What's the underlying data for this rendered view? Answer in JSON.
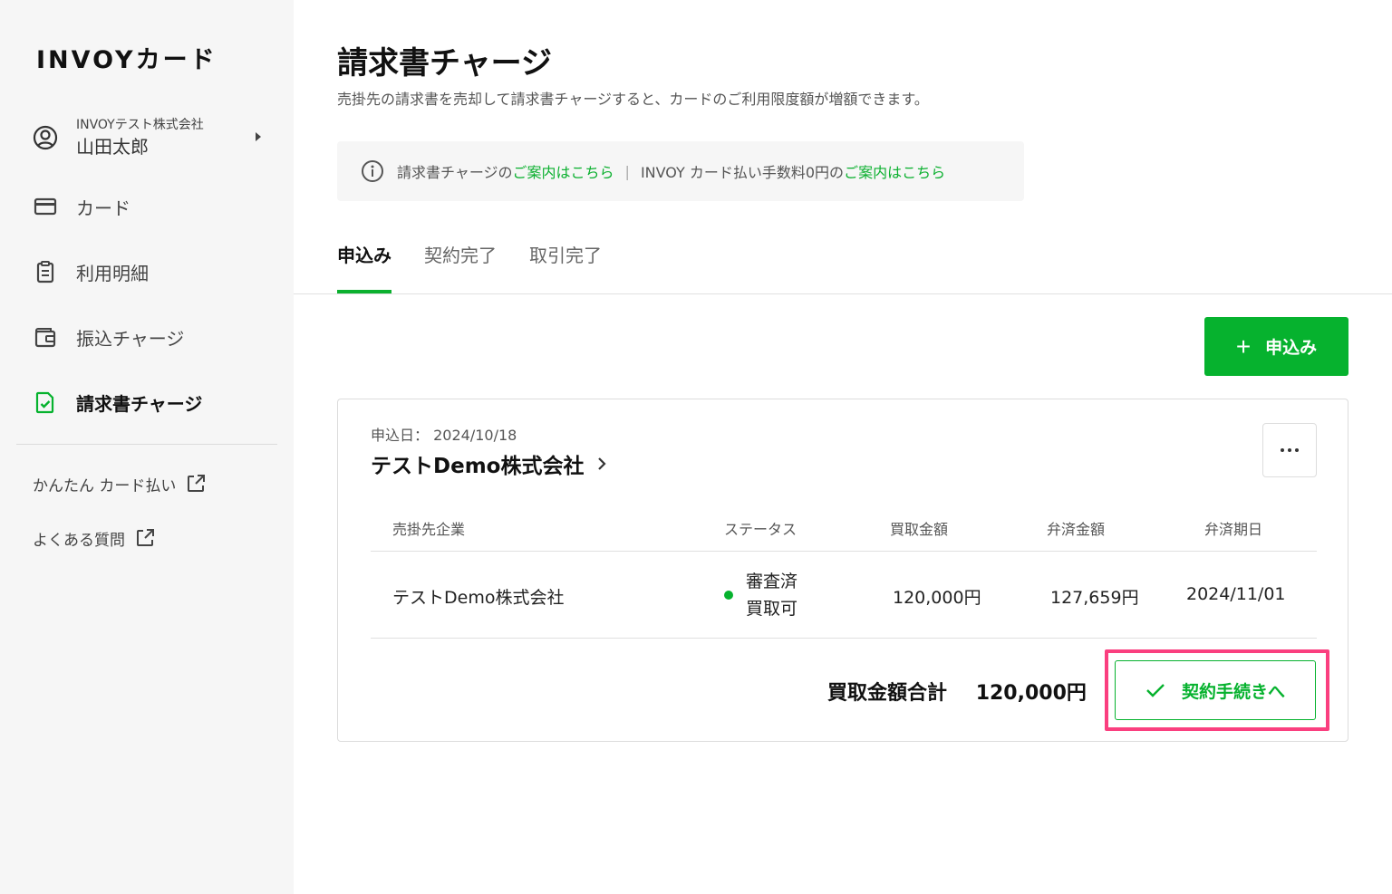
{
  "sidebar": {
    "logo": "INVOYカード",
    "user": {
      "company": "INVOYテスト株式会社",
      "name": "山田太郎"
    },
    "items": [
      {
        "label": "カード",
        "icon": "card-icon"
      },
      {
        "label": "利用明細",
        "icon": "clipboard-icon"
      },
      {
        "label": "振込チャージ",
        "icon": "wallet-icon"
      },
      {
        "label": "請求書チャージ",
        "icon": "invoice-check-icon",
        "active": true
      }
    ],
    "external": [
      {
        "label": "かんたん カード払い",
        "icon": "external-link-icon"
      },
      {
        "label": "よくある質問",
        "icon": "external-link-icon"
      }
    ]
  },
  "page": {
    "title": "請求書チャージ",
    "subtitle": "売掛先の請求書を売却して請求書チャージすると、カードのご利用限度額が増額できます。"
  },
  "notice": {
    "text1": "請求書チャージの",
    "link1": "ご案内はこちら",
    "separator": "|",
    "text2": "INVOY カード払い手数料0円の",
    "link2": "ご案内はこちら"
  },
  "tabs": [
    {
      "label": "申込み",
      "active": true
    },
    {
      "label": "契約完了"
    },
    {
      "label": "取引完了"
    }
  ],
  "apply_button": {
    "plus": "+",
    "label": "申込み"
  },
  "application": {
    "date_label": "申込日：",
    "date": "2024/10/18",
    "company": "テストDemo株式会社",
    "columns": [
      "売掛先企業",
      "ステータス",
      "買取金額",
      "弁済金額",
      "弁済期日"
    ],
    "row": {
      "company": "テストDemo株式会社",
      "status_line1": "審査済",
      "status_line2": "買取可",
      "purchase_amount": "120,000円",
      "repayment_amount": "127,659円",
      "due_date": "2024/11/01"
    },
    "total_label": "買取金額合計",
    "total_amount": "120,000円",
    "contract_button": "契約手続きへ"
  },
  "colors": {
    "accent": "#06b22e",
    "highlight": "#fa3f7f"
  }
}
